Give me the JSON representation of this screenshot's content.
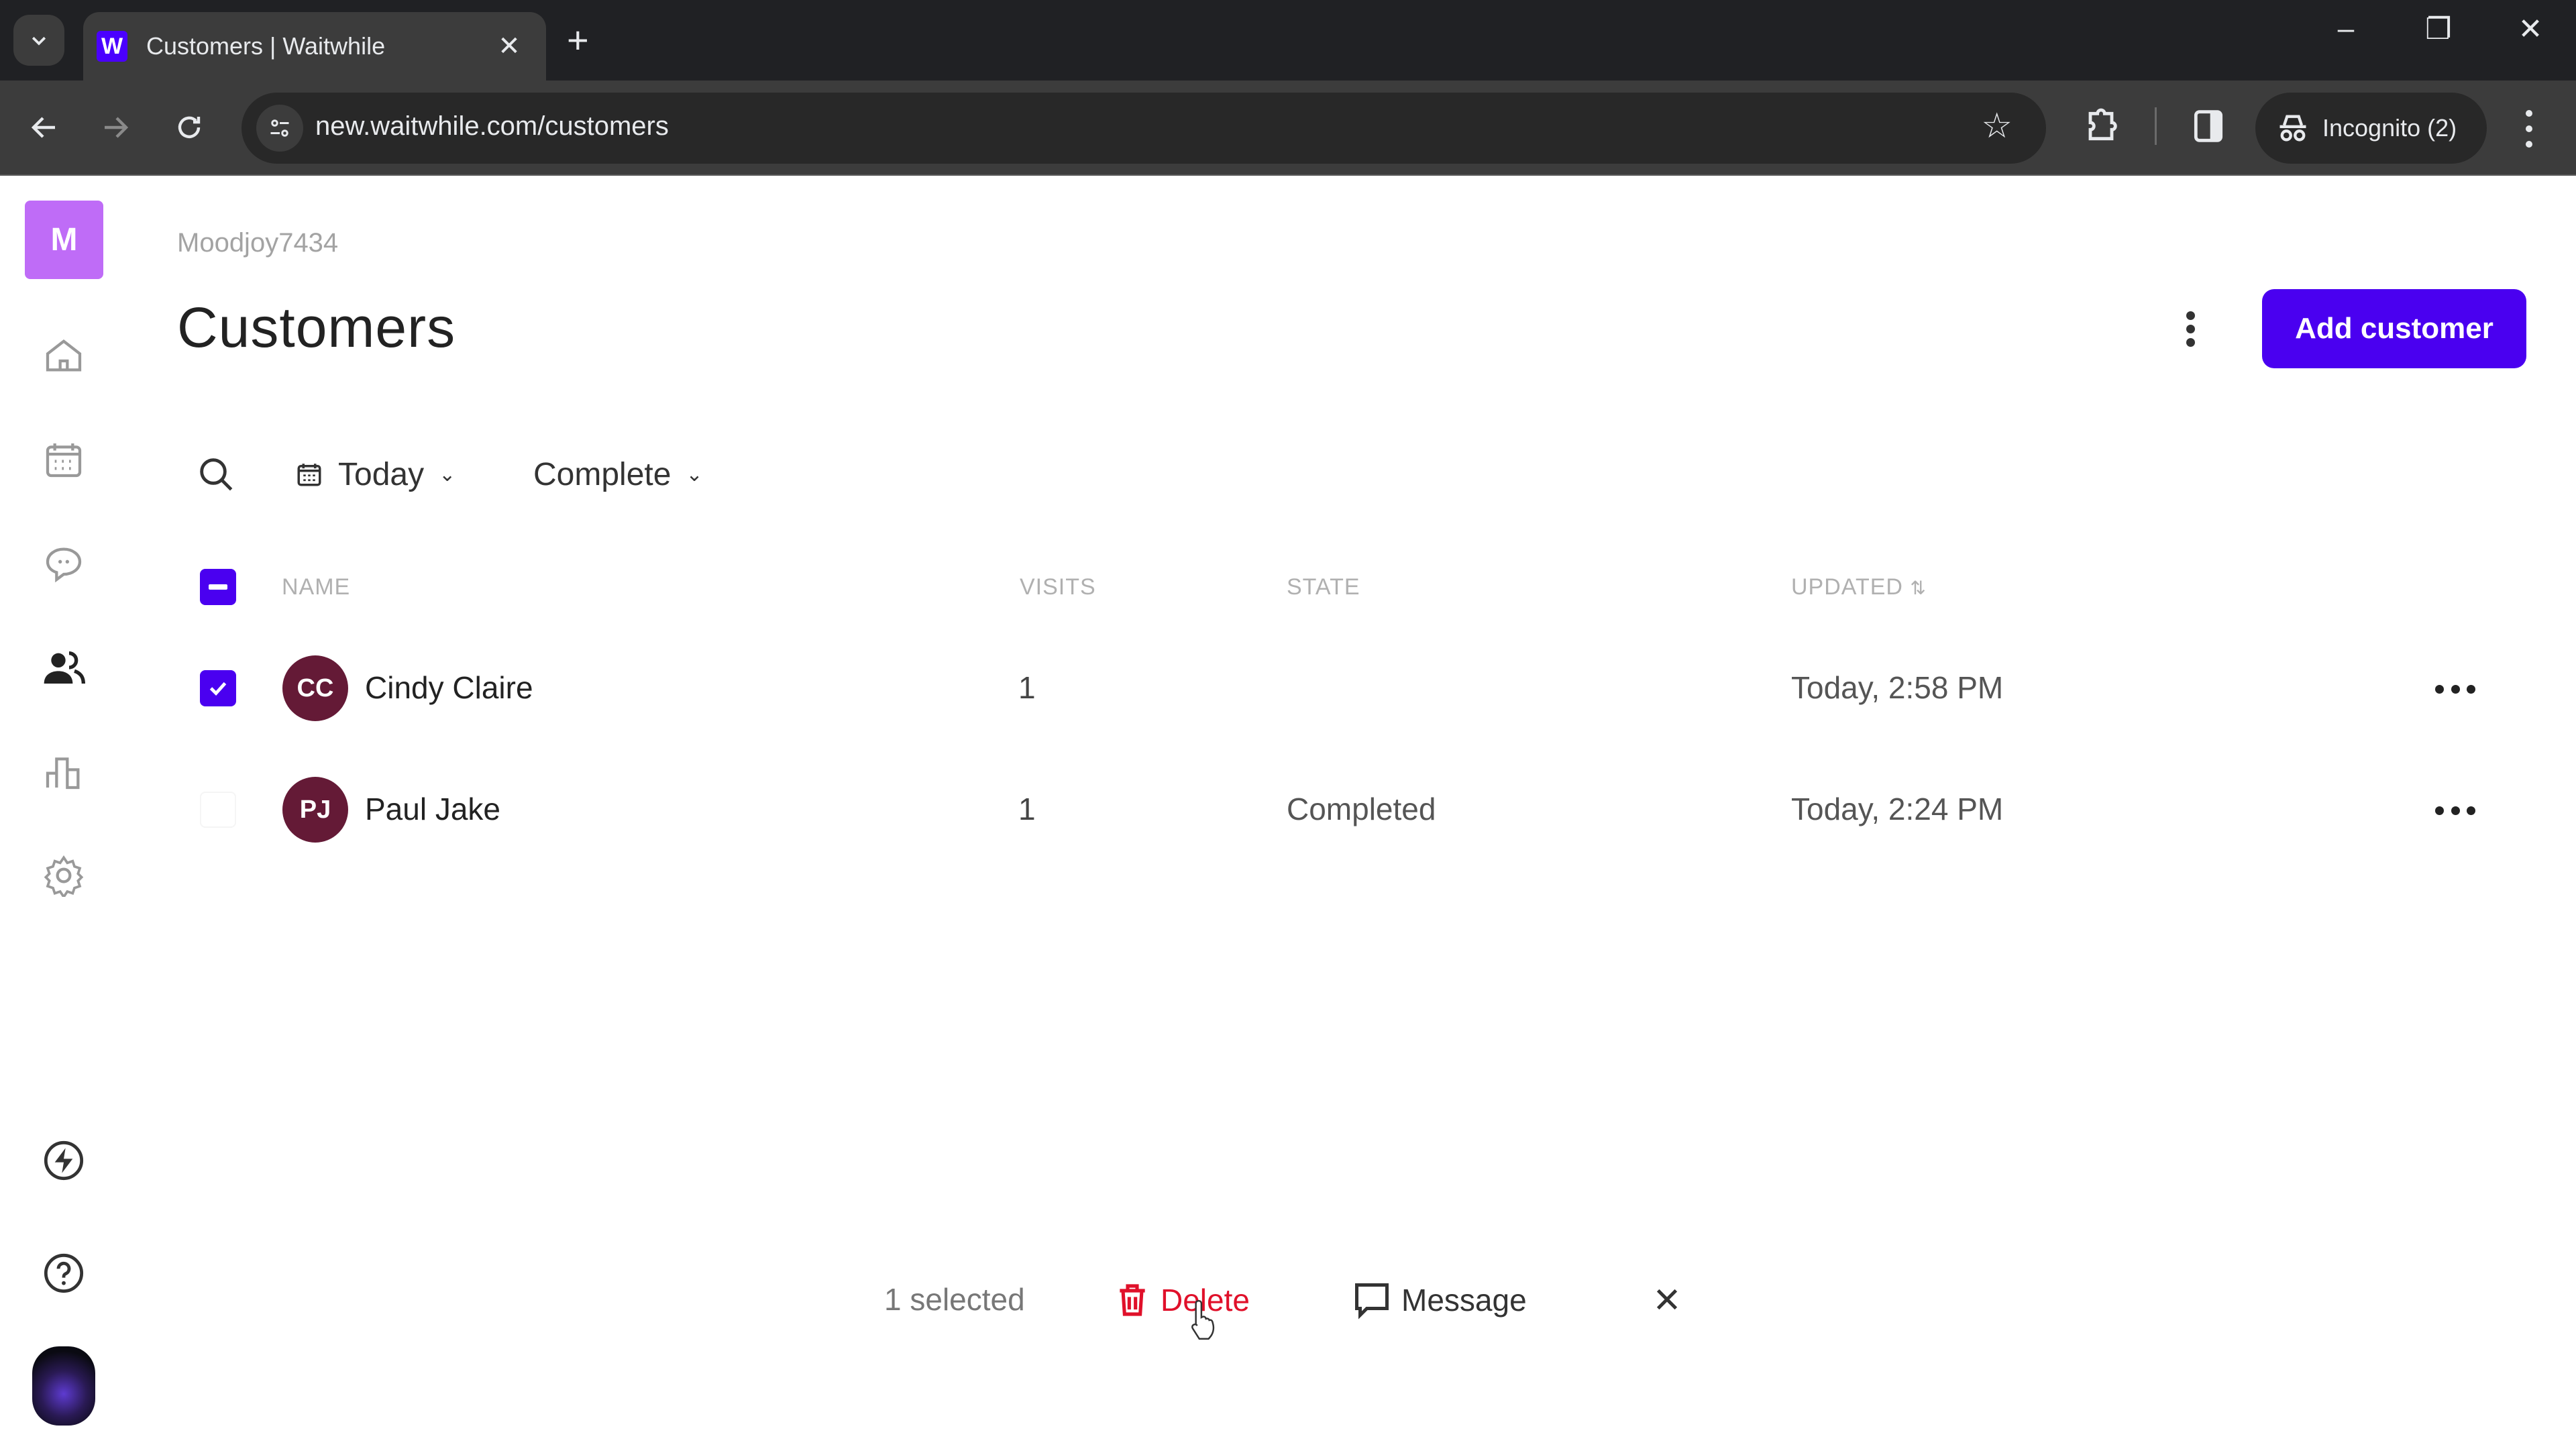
{
  "browser": {
    "tab_title": "Customers | Waitwhile",
    "favicon_letter": "W",
    "url": "new.waitwhile.com/customers",
    "incognito_label": "Incognito (2)",
    "new_tab_symbol": "+",
    "close_tab_symbol": "✕",
    "window_controls": {
      "minimize": "–",
      "restore": "❐",
      "close": "✕"
    }
  },
  "sidebar": {
    "logo_letter": "M",
    "logo_color": "#bf6cf7",
    "items": [
      {
        "name": "home",
        "icon": "home-icon",
        "active": false
      },
      {
        "name": "calendar",
        "icon": "calendar-icon",
        "active": false
      },
      {
        "name": "messages",
        "icon": "chat-icon",
        "active": false
      },
      {
        "name": "customers",
        "icon": "users-icon",
        "active": true
      },
      {
        "name": "analytics",
        "icon": "bar-chart-icon",
        "active": false
      },
      {
        "name": "settings",
        "icon": "gear-icon",
        "active": false
      }
    ],
    "bottom_items": [
      {
        "name": "whats-new",
        "icon": "lightning-icon"
      },
      {
        "name": "help",
        "icon": "help-icon"
      }
    ]
  },
  "header": {
    "workspace": "Moodjoy7434",
    "title": "Customers",
    "add_button": "Add customer",
    "accent_color": "#4a00f0"
  },
  "filters": {
    "date": "Today",
    "status": "Complete"
  },
  "table": {
    "columns": [
      "NAME",
      "VISITS",
      "STATE",
      "UPDATED"
    ],
    "sort_indicator": "⇅",
    "rows": [
      {
        "initials": "CC",
        "name": "Cindy Claire",
        "visits": "1",
        "state": "",
        "updated": "Today, 2:58 PM",
        "selected": true
      },
      {
        "initials": "PJ",
        "name": "Paul Jake",
        "visits": "1",
        "state": "Completed",
        "updated": "Today, 2:24 PM",
        "selected": false
      }
    ]
  },
  "bulk_actions": {
    "count_label": "1 selected",
    "delete_label": "Delete",
    "message_label": "Message",
    "delete_color": "#e0102a"
  }
}
